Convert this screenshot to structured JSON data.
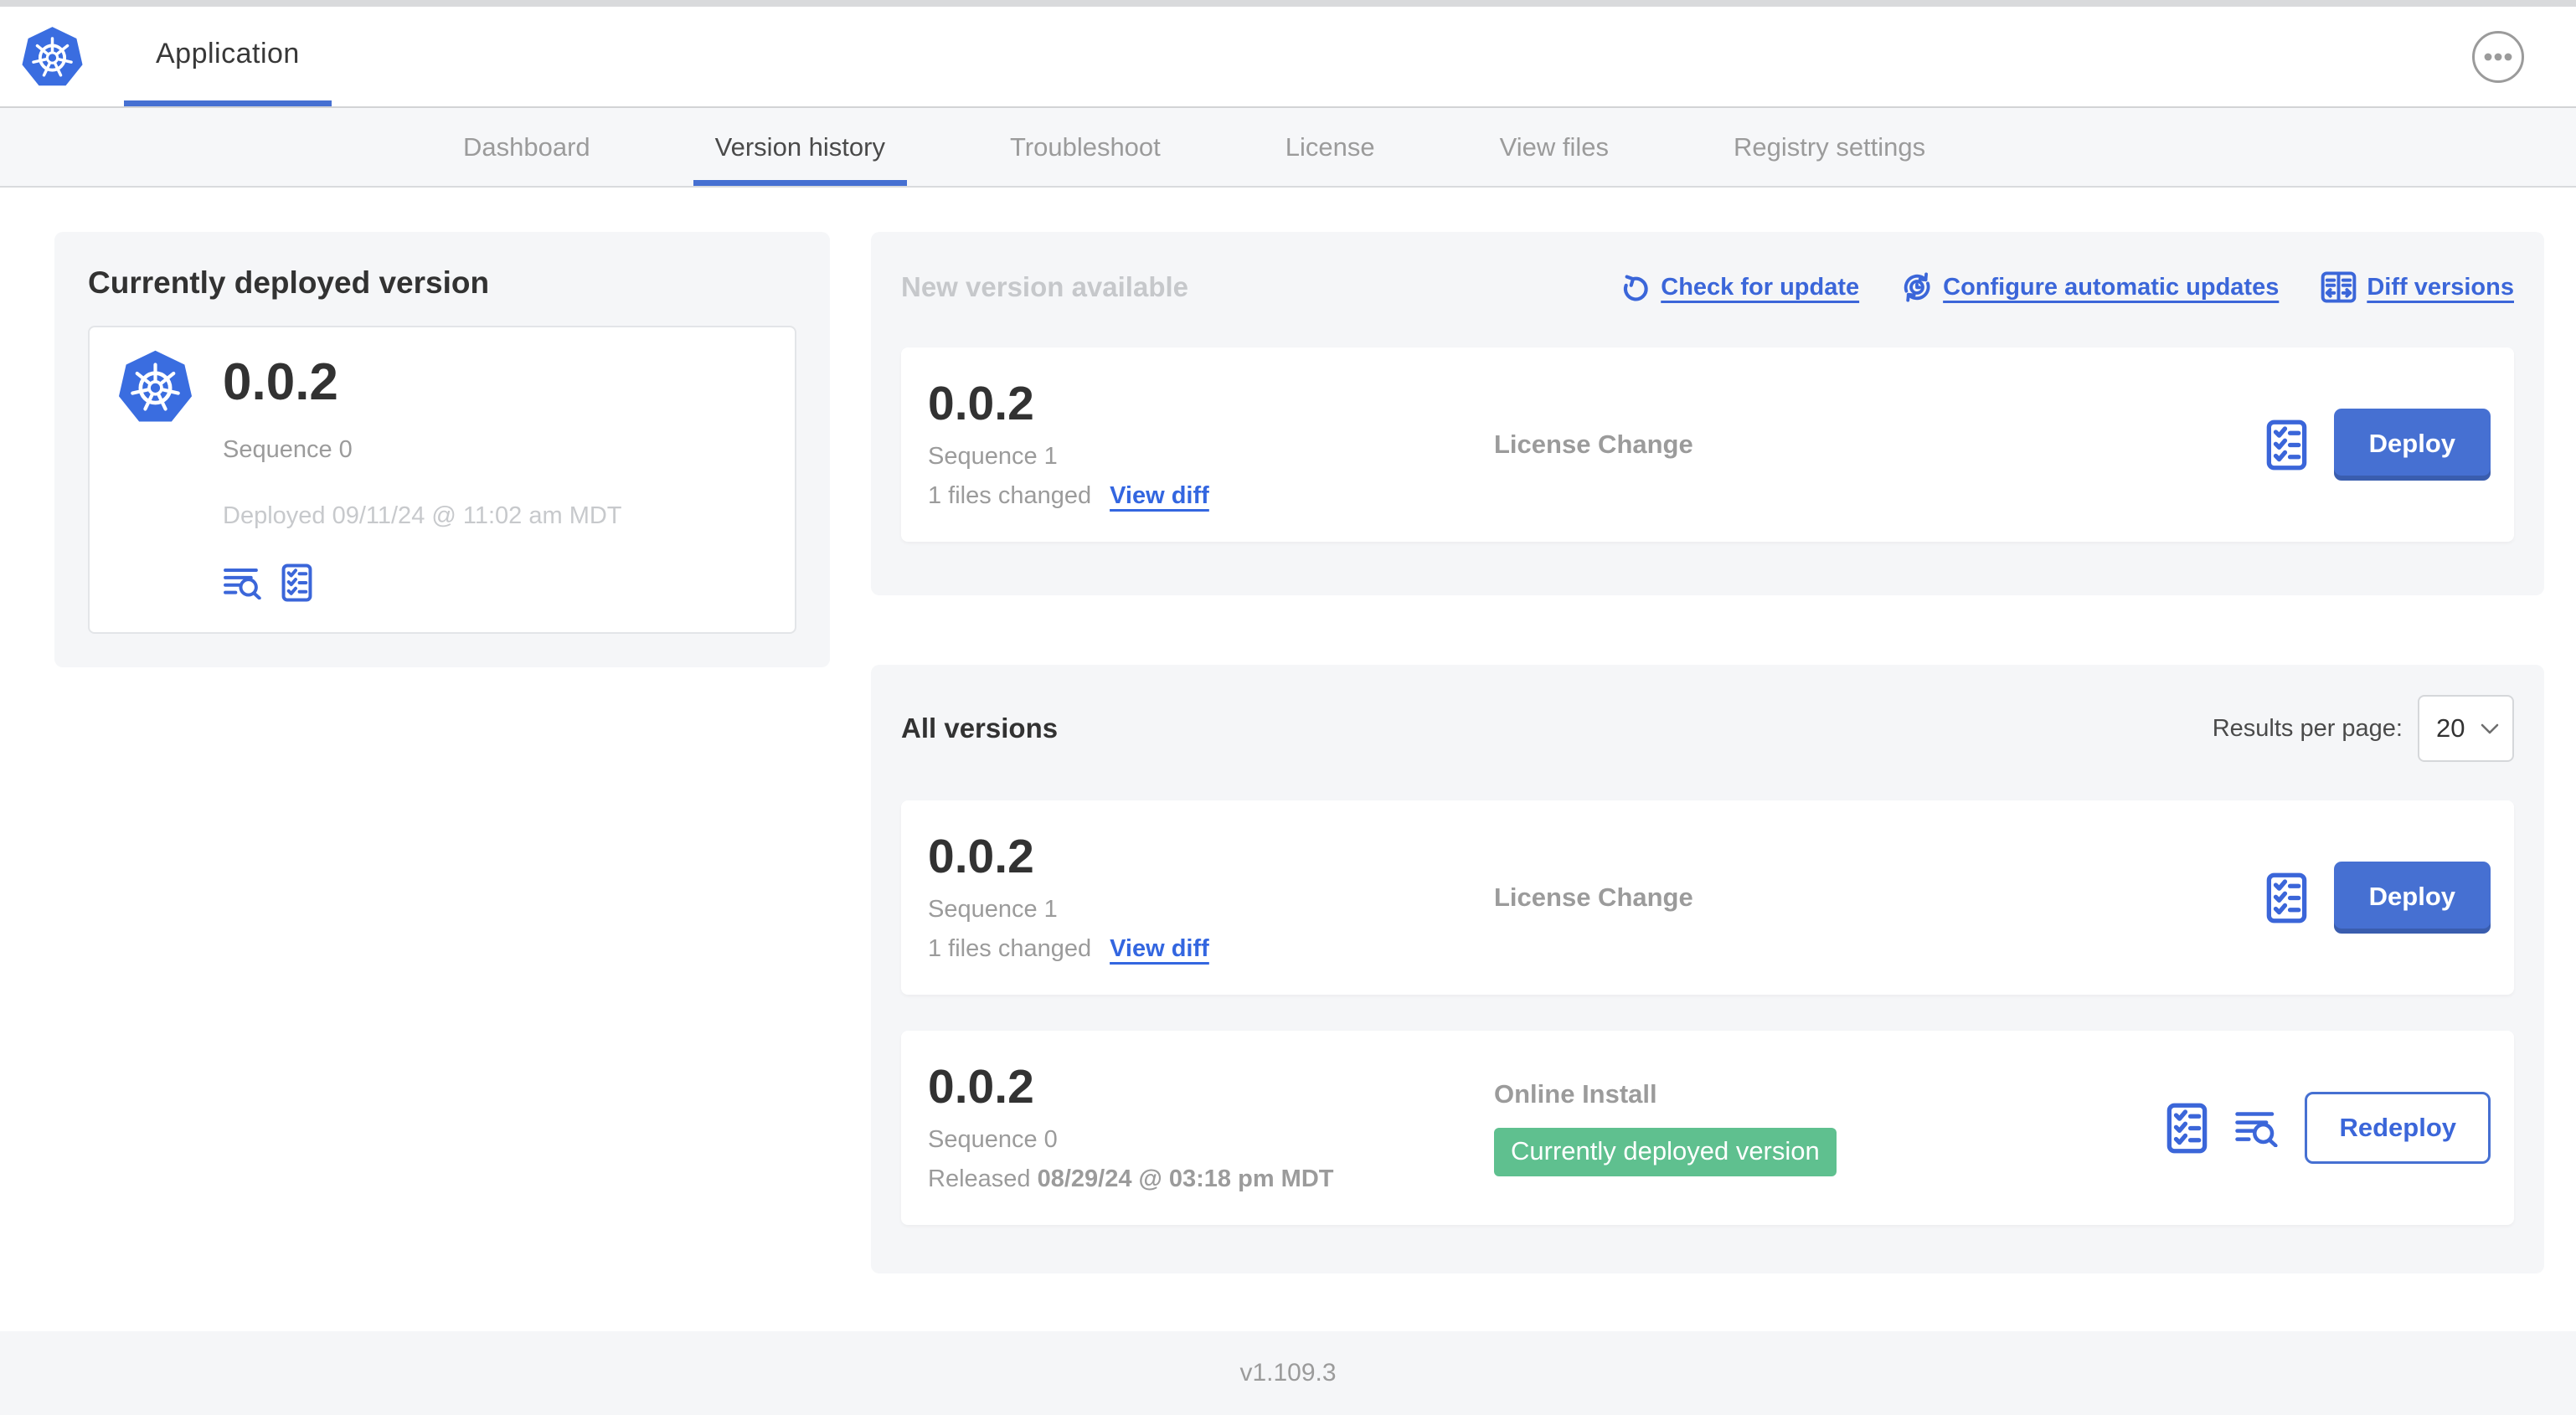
{
  "colors": {
    "accent_blue": "#4670d2",
    "link_blue": "#3b66d9",
    "badge_green": "#5fc08f",
    "card_background": "#f5f6f8",
    "muted_text": "#9b9b9b"
  },
  "header": {
    "app_tab_label": "Application"
  },
  "nav": {
    "active_tab": "Version history",
    "tabs": [
      {
        "label": "Dashboard"
      },
      {
        "label": "Version history"
      },
      {
        "label": "Troubleshoot"
      },
      {
        "label": "License"
      },
      {
        "label": "View files"
      },
      {
        "label": "Registry settings"
      }
    ]
  },
  "current_version": {
    "title": "Currently deployed version",
    "version": "0.0.2",
    "sequence": "Sequence 0",
    "deployed": "Deployed 09/11/24 @ 11:02 am MDT"
  },
  "new_version": {
    "title": "New version available",
    "actions": {
      "check_for_update": "Check for update",
      "configure_automatic_updates": "Configure automatic updates",
      "diff_versions": "Diff versions"
    },
    "row": {
      "version": "0.0.2",
      "sequence": "Sequence 1",
      "files_changed": "1 files changed",
      "view_diff": "View diff",
      "source": "License Change",
      "deploy_label": "Deploy"
    }
  },
  "all_versions": {
    "title": "All versions",
    "results_per_page_label": "Results per page:",
    "results_per_page_value": "20",
    "rows": [
      {
        "version": "0.0.2",
        "sequence": "Sequence 1",
        "files_changed": "1 files changed",
        "view_diff": "View diff",
        "source": "License Change",
        "deploy_label": "Deploy"
      },
      {
        "version": "0.0.2",
        "sequence": "Sequence 0",
        "released_label": "Released",
        "released_date": "08/29/24 @ 03:18 pm MDT",
        "source": "Online Install",
        "badge": "Currently deployed version",
        "redeploy_label": "Redeploy"
      }
    ]
  },
  "footer": {
    "app_version": "v1.109.3"
  },
  "icons": {
    "logo": "kubernetes-logo",
    "menu": "ellipsis-menu-icon",
    "logs": "logs-icon",
    "checklist": "checklist-icon",
    "check_update": "refresh-icon",
    "auto_update": "clock-refresh-icon",
    "diff": "diff-icon",
    "select_chevron": "chevron-down-icon"
  }
}
